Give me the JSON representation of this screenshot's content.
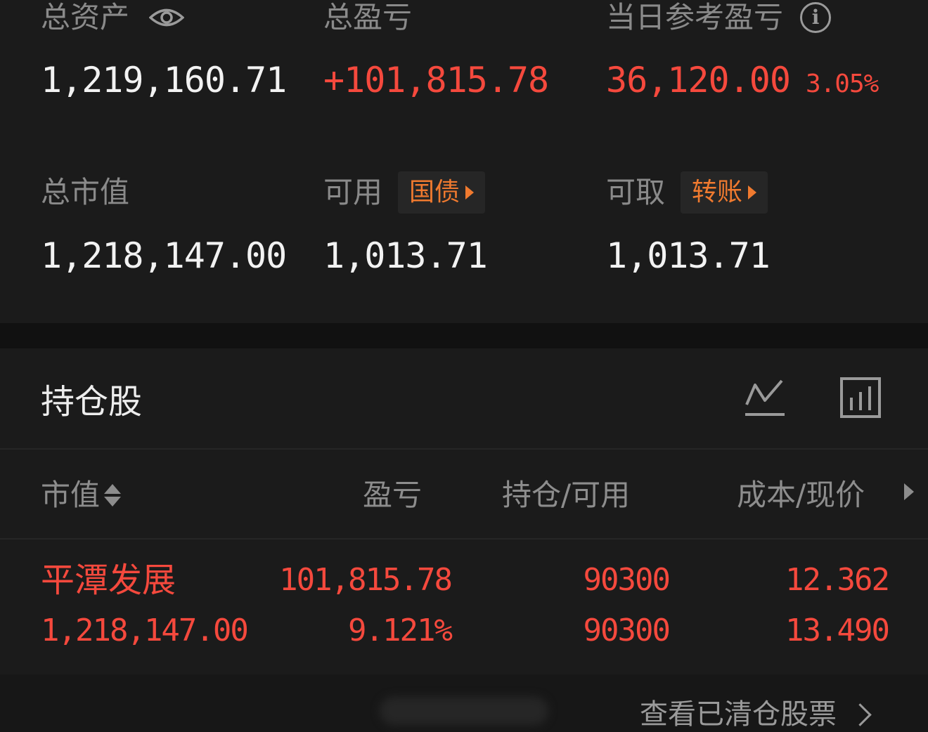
{
  "summary": {
    "total_assets": {
      "label": "总资产",
      "value": "1,219,160.71",
      "icon": "eye-icon"
    },
    "total_pnl": {
      "label": "总盈亏",
      "value": "+101,815.78"
    },
    "daily_pnl": {
      "label": "当日参考盈亏",
      "value": "36,120.00",
      "percent": "3.05%",
      "icon": "info-icon"
    },
    "market_value": {
      "label": "总市值",
      "value": "1,218,147.00"
    },
    "available": {
      "label": "可用",
      "chip": "国债",
      "value": "1,013.71"
    },
    "withdrawable": {
      "label": "可取",
      "chip": "转账",
      "value": "1,013.71"
    }
  },
  "holdings": {
    "title": "持仓股",
    "icons": [
      "line-chart-icon",
      "bar-chart-icon"
    ],
    "columns": {
      "market_value": "市值",
      "pnl": "盈亏",
      "position": "持仓/可用",
      "cost_price": "成本/现价"
    },
    "rows": [
      {
        "name": "平潭发展",
        "market_value": "1,218,147.00",
        "pnl": "101,815.78",
        "pnl_pct": "9.121%",
        "position": "90300",
        "available": "90300",
        "cost": "12.362",
        "price": "13.490"
      }
    ],
    "cleared_link": "查看已清仓股票"
  },
  "colors": {
    "background": "#121212",
    "panel": "#1b1b1b",
    "up_red": "#f5493d",
    "chip_orange": "#f07a2f"
  }
}
